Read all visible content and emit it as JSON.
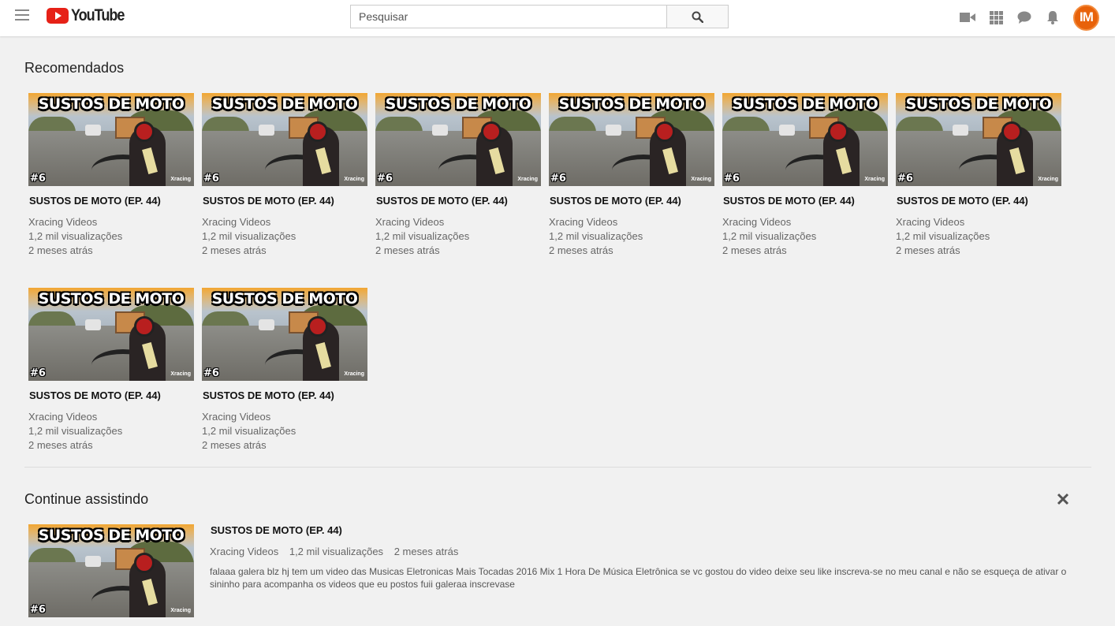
{
  "header": {
    "logo_text": "YouTube",
    "search_placeholder": "Pesquisar",
    "avatar_initials": "IM"
  },
  "recommended": {
    "title": "Recomendados",
    "videos": [
      {
        "title": "SUSTOS DE MOTO (EP. 44)",
        "channel": "Xracing Videos",
        "views": "1,2 mil visualizações",
        "age": "2 meses atrás"
      },
      {
        "title": "SUSTOS DE MOTO (EP. 44)",
        "channel": "Xracing Videos",
        "views": "1,2 mil visualizações",
        "age": "2 meses atrás"
      },
      {
        "title": "SUSTOS DE MOTO (EP. 44)",
        "channel": "Xracing Videos",
        "views": "1,2 mil visualizações",
        "age": "2 meses atrás"
      },
      {
        "title": "SUSTOS DE MOTO (EP. 44)",
        "channel": "Xracing Videos",
        "views": "1,2 mil visualizações",
        "age": "2 meses atrás"
      },
      {
        "title": "SUSTOS DE MOTO (EP. 44)",
        "channel": "Xracing Videos",
        "views": "1,2 mil visualizações",
        "age": "2 meses atrás"
      },
      {
        "title": "SUSTOS DE MOTO (EP. 44)",
        "channel": "Xracing Videos",
        "views": "1,2 mil visualizações",
        "age": "2 meses atrás"
      },
      {
        "title": "SUSTOS DE MOTO (EP. 44)",
        "channel": "Xracing Videos",
        "views": "1,2 mil visualizações",
        "age": "2 meses atrás"
      },
      {
        "title": "SUSTOS DE MOTO (EP. 44)",
        "channel": "Xracing Videos",
        "views": "1,2 mil visualizações",
        "age": "2 meses atrás"
      }
    ]
  },
  "thumbnail": {
    "banner_text": "SUSTOS DE MOTO",
    "episode_badge": "#6",
    "brand": "Xracing"
  },
  "continue_watching": {
    "title": "Continue assistindo",
    "video": {
      "title": "SUSTOS DE MOTO (EP. 44)",
      "channel": "Xracing Videos",
      "views": "1,2 mil visualizações",
      "age": "2 meses atrás",
      "description": "falaaa galera blz hj tem um video das Musicas Eletronicas Mais Tocadas 2016 Mix 1 Hora De Música Eletrônica se vc gostou do video deixe seu like inscreva-se no meu canal e não se esqueça de ativar o sininho para acompanha os videos que eu postos fuii galeraa inscrevase"
    }
  },
  "colors": {
    "brand_red": "#e62117",
    "avatar_orange": "#e8620a",
    "background": "#f1f1f1"
  }
}
